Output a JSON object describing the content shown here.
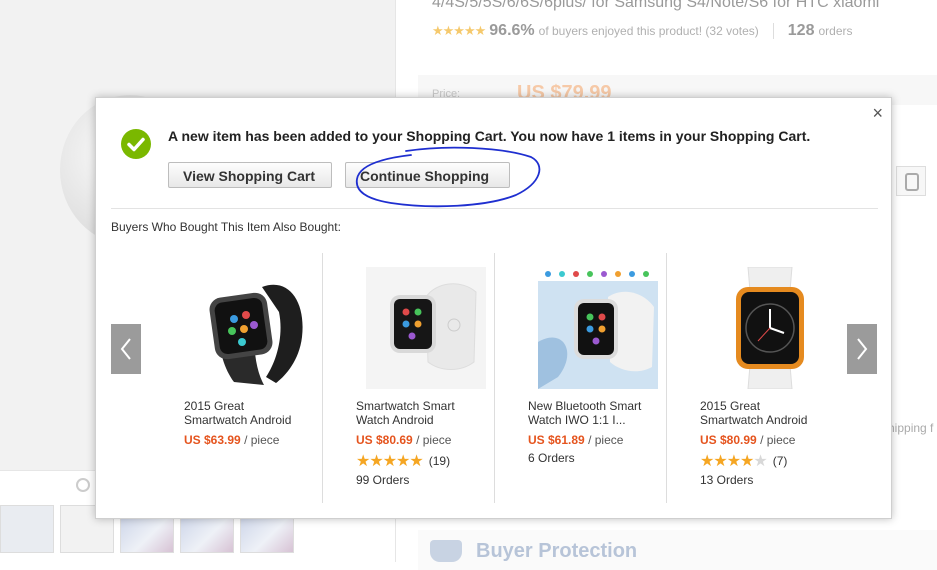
{
  "background": {
    "product_title": "4/4S/5/5S/6/6S/6plus/ for Samsung S4/Note/S6 for HTC xiaomi",
    "rating_percent": "96.6%",
    "rating_text": "of buyers enjoyed this product! (32 votes)",
    "orders_count": "128",
    "orders_label": "orders",
    "price_label": "Price:",
    "price_value": "US $79.99",
    "shipping_text": "hipping f",
    "buyer_protection": "Buyer Protection"
  },
  "modal": {
    "close_symbol": "×",
    "message": "A new item has been added to your Shopping Cart. You now have 1 items in your Shopping Cart.",
    "view_cart_label": "View Shopping Cart",
    "continue_label": "Continue Shopping",
    "also_bought_title": "Buyers Who Bought This Item Also Bought:",
    "products": [
      {
        "name_line1": "2015 Great",
        "name_line2": "Smartwatch Android",
        "price": "US $63.99",
        "unit": "/ piece",
        "stars": "",
        "votes": "",
        "orders": ""
      },
      {
        "name_line1": "Smartwatch Smart",
        "name_line2": "Watch Android",
        "price": "US $80.69",
        "unit": "/ piece",
        "rating": 5,
        "stars": "★★★★★",
        "votes": "(19)",
        "orders": "99 Orders"
      },
      {
        "name_line1": "New Bluetooth Smart",
        "name_line2": "Watch IWO 1:1 I...",
        "price": "US $61.89",
        "unit": "/ piece",
        "stars": "",
        "votes": "",
        "orders": "6 Orders"
      },
      {
        "name_line1": "2015 Great",
        "name_line2": "Smartwatch Android",
        "price": "US $80.99",
        "unit": "/ piece",
        "rating": 4,
        "stars": "★★★★",
        "stars_empty": "★",
        "votes": "(7)",
        "orders": "13 Orders"
      }
    ]
  },
  "colors": {
    "accent_green": "#7ab800",
    "price_orange": "#e5541e",
    "star_gold": "#f5a623",
    "scribble_blue": "#1f2fd0"
  }
}
